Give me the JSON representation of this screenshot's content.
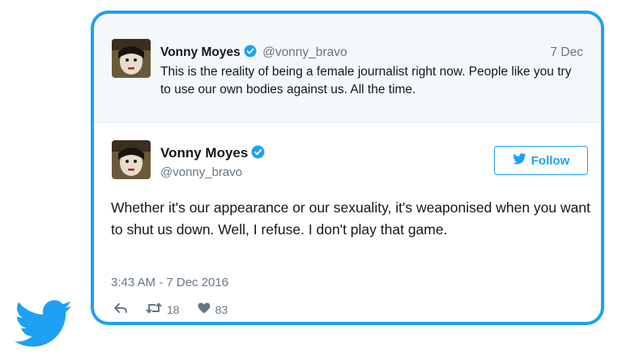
{
  "parent_tweet": {
    "name": "Vonny Moyes",
    "handle": "@vonny_bravo",
    "date": "7 Dec",
    "text": "This is the reality of being a female journalist right now. People like you try to use our own bodies against us. All the time."
  },
  "main_tweet": {
    "name": "Vonny Moyes",
    "handle": "@vonny_bravo",
    "follow_label": "Follow",
    "text": "Whether it's our appearance or our sexuality, it's weaponised when you want to shut us down. Well, I refuse. I don't play that game.",
    "timestamp": "3:43 AM - 7 Dec 2016",
    "retweets": "18",
    "likes": "83"
  },
  "icons": {
    "verified": "verified-badge-icon",
    "reply": "reply-icon",
    "retweet": "retweet-icon",
    "like": "heart-icon",
    "brand": "twitter-bird-icon"
  },
  "colors": {
    "brand": "#1da1f2",
    "muted": "#657786",
    "parent_bg": "#f5f8fa"
  }
}
